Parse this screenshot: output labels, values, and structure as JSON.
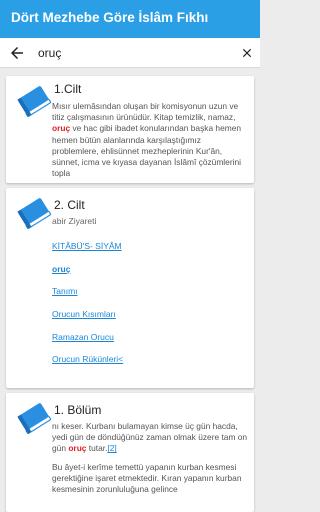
{
  "app": {
    "title": "Dört Mezhebe Göre İslâm Fıkhı"
  },
  "search": {
    "query": "oruç",
    "back_icon": "arrow-left-icon",
    "clear_icon": "close-icon"
  },
  "colors": {
    "appbar": "#2a9fe6",
    "icon": "#2a8fe0",
    "link": "#1a86d8",
    "highlight": "#e02020"
  },
  "results": [
    {
      "title": "1.Cilt",
      "icon": "book-icon",
      "body_before": "Mısır ulemâsından oluşan bir komisyonun uzun ve titiz çalışmasının ürünüdür. Kitap temizlik, namaz, ",
      "highlight": "oruç",
      "body_after": " ve hac gibi ibadet konularından başka hemen hemen bütün alanlarında karşılaştığımız problemlere, ehlisünnet mezheplerinin Kur'ân, sünnet, icma ve kıyasa dayanan İslâmî çözümlerini topla"
    },
    {
      "title": "2. Cilt",
      "icon": "book-icon",
      "subtitle": "abir Ziyareti",
      "links": [
        "KİTÂBÜ'S- SİYÂM",
        "oruç",
        "Tanımı",
        "Orucun Kısımları",
        "Ramazan Orucu",
        "Orucun Rükünleri<"
      ]
    },
    {
      "title": "1. Bölüm",
      "icon": "book-icon",
      "p1_before": "nı keser. Kurbanı bulamayan kimse üç gün hacda, yedi gün de döndüğünüz zaman olmak üzere tam on gün ",
      "p1_highlight": "oruç",
      "p1_after": " tutar.",
      "footnote": "[2]",
      "p2": "Bu âyet-i kerîme temettü yapanın kurban kesmesi gerektiğine işaret etmektedir. Kıran yapanın kurban kesmesinin zorunluluğuna gelince"
    }
  ]
}
